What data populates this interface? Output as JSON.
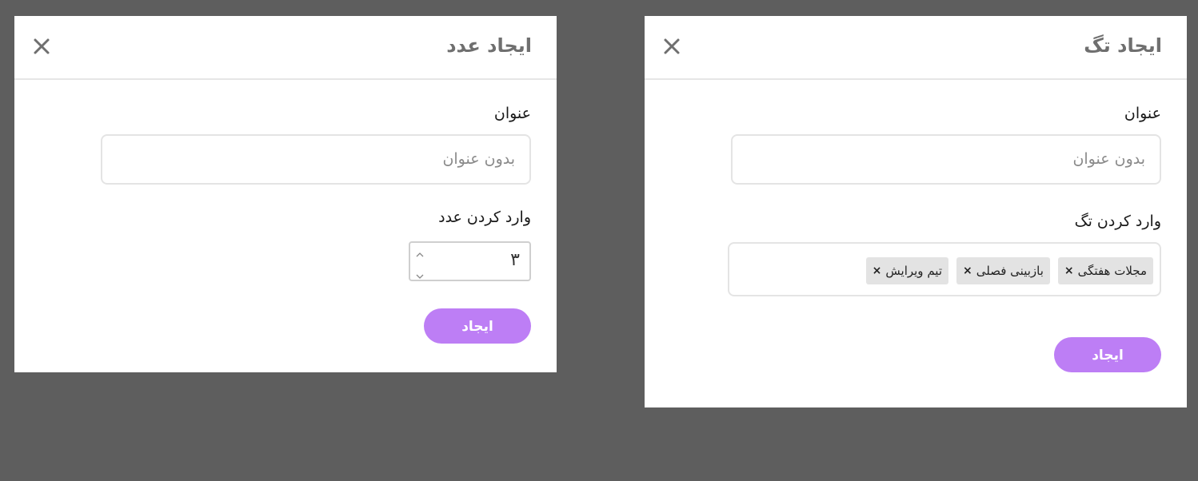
{
  "number_dialog": {
    "title": "ایجاد عدد",
    "close_icon": "close-icon",
    "title_field": {
      "label": "عنوان",
      "placeholder": "بدون عنوان",
      "value": ""
    },
    "number_field": {
      "label": "وارد کردن عدد",
      "value": "۳"
    },
    "submit_label": "ایجاد"
  },
  "tag_dialog": {
    "title": "ایجاد تگ",
    "close_icon": "close-icon",
    "title_field": {
      "label": "عنوان",
      "placeholder": "بدون عنوان",
      "value": ""
    },
    "tag_field": {
      "label": "وارد کردن تگ",
      "tags": [
        {
          "label": "مجلات هفتگی",
          "remove": "×"
        },
        {
          "label": "بازبینی فصلی",
          "remove": "×"
        },
        {
          "label": "تیم ویرایش",
          "remove": "×"
        }
      ]
    },
    "submit_label": "ایجاد"
  },
  "colors": {
    "backdrop": "#5e5e5e",
    "accent": "#bd7ef5",
    "chip_bg": "#e3e3e3"
  }
}
